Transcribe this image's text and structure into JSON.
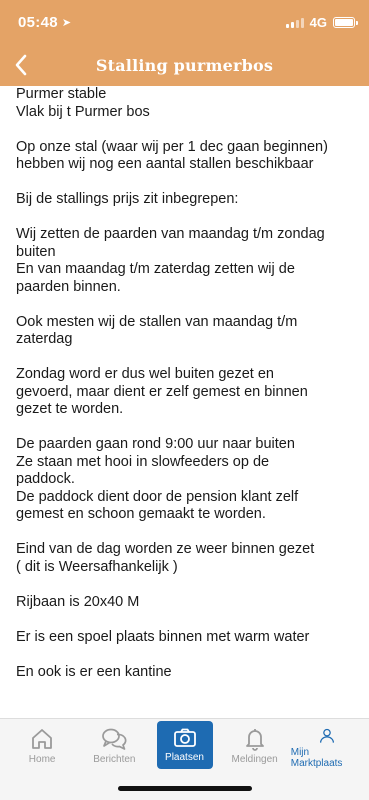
{
  "status": {
    "time": "05:48",
    "network": "4G"
  },
  "header": {
    "title": "Stalling purmerbos"
  },
  "content": {
    "paragraphs": [
      [
        "Purmer stable",
        "Vlak bij t Purmer bos"
      ],
      [
        "Op onze stal (waar wij per 1 dec gaan beginnen)",
        "hebben wij nog een aantal stallen beschikbaar"
      ],
      [
        "Bij de stallings prijs zit inbegrepen:"
      ],
      [
        "Wij zetten de paarden van maandag t/m zondag",
        "buiten",
        "En van maandag t/m zaterdag zetten wij de",
        "paarden binnen."
      ],
      [
        "Ook mesten wij de stallen van maandag t/m",
        "zaterdag"
      ],
      [
        "Zondag word er dus wel buiten gezet en",
        "gevoerd, maar dient er zelf gemest en binnen",
        "gezet te worden."
      ],
      [
        "De paarden gaan rond 9:00 uur naar buiten",
        "Ze staan met hooi in slowfeeders op de",
        "paddock.",
        "De paddock dient door de pension klant zelf",
        "gemest en schoon gemaakt te worden."
      ],
      [
        "Eind van de dag worden ze weer binnen gezet",
        "( dit is Weersafhankelijk )"
      ],
      [
        "Rijbaan is 20x40 M"
      ],
      [
        "Er is een spoel plaats binnen met warm water"
      ],
      [
        "En ook is er een kantine"
      ]
    ]
  },
  "tabbar": {
    "tabs": [
      {
        "label": "Home",
        "icon": "home-icon"
      },
      {
        "label": "Berichten",
        "icon": "chat-bubbles-icon"
      },
      {
        "label": "Plaatsen",
        "icon": "camera-icon"
      },
      {
        "label": "Meldingen",
        "icon": "bell-icon"
      },
      {
        "label": "Mijn Marktplaats",
        "icon": "user-icon"
      }
    ]
  },
  "colors": {
    "header_bg": "#e4a366",
    "active_tab": "#1e6bb2",
    "inactive_tab": "#9a9a9a"
  }
}
